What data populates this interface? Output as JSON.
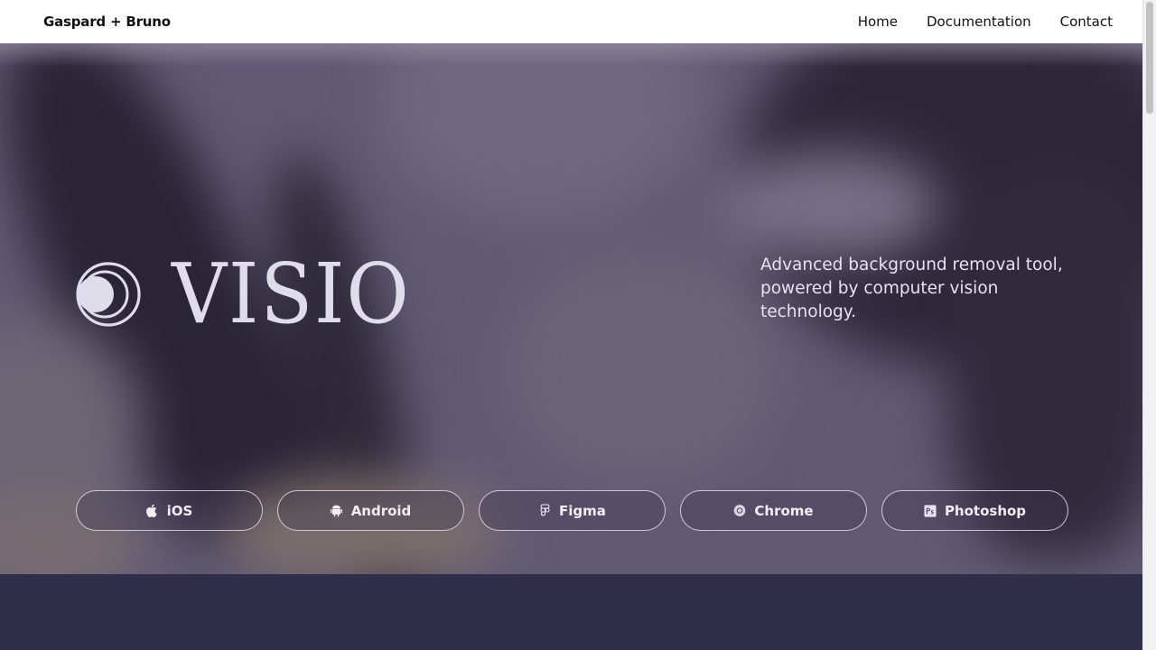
{
  "nav": {
    "brand": "Gaspard + Bruno",
    "links": [
      "Home",
      "Documentation",
      "Contact"
    ]
  },
  "hero": {
    "product_name": "VISIO",
    "tagline": "Advanced background removal tool, powered by computer vision technology.",
    "platforms": [
      {
        "label": "iOS",
        "icon": "apple-icon"
      },
      {
        "label": "Android",
        "icon": "android-icon"
      },
      {
        "label": "Figma",
        "icon": "figma-icon"
      },
      {
        "label": "Chrome",
        "icon": "chrome-icon"
      },
      {
        "label": "Photoshop",
        "icon": "photoshop-icon"
      }
    ]
  },
  "colors": {
    "nav_bg": "#ffffff",
    "hero_bg": "#615a74",
    "hero_text": "#e0ddea",
    "footer_bg": "#302e48"
  }
}
